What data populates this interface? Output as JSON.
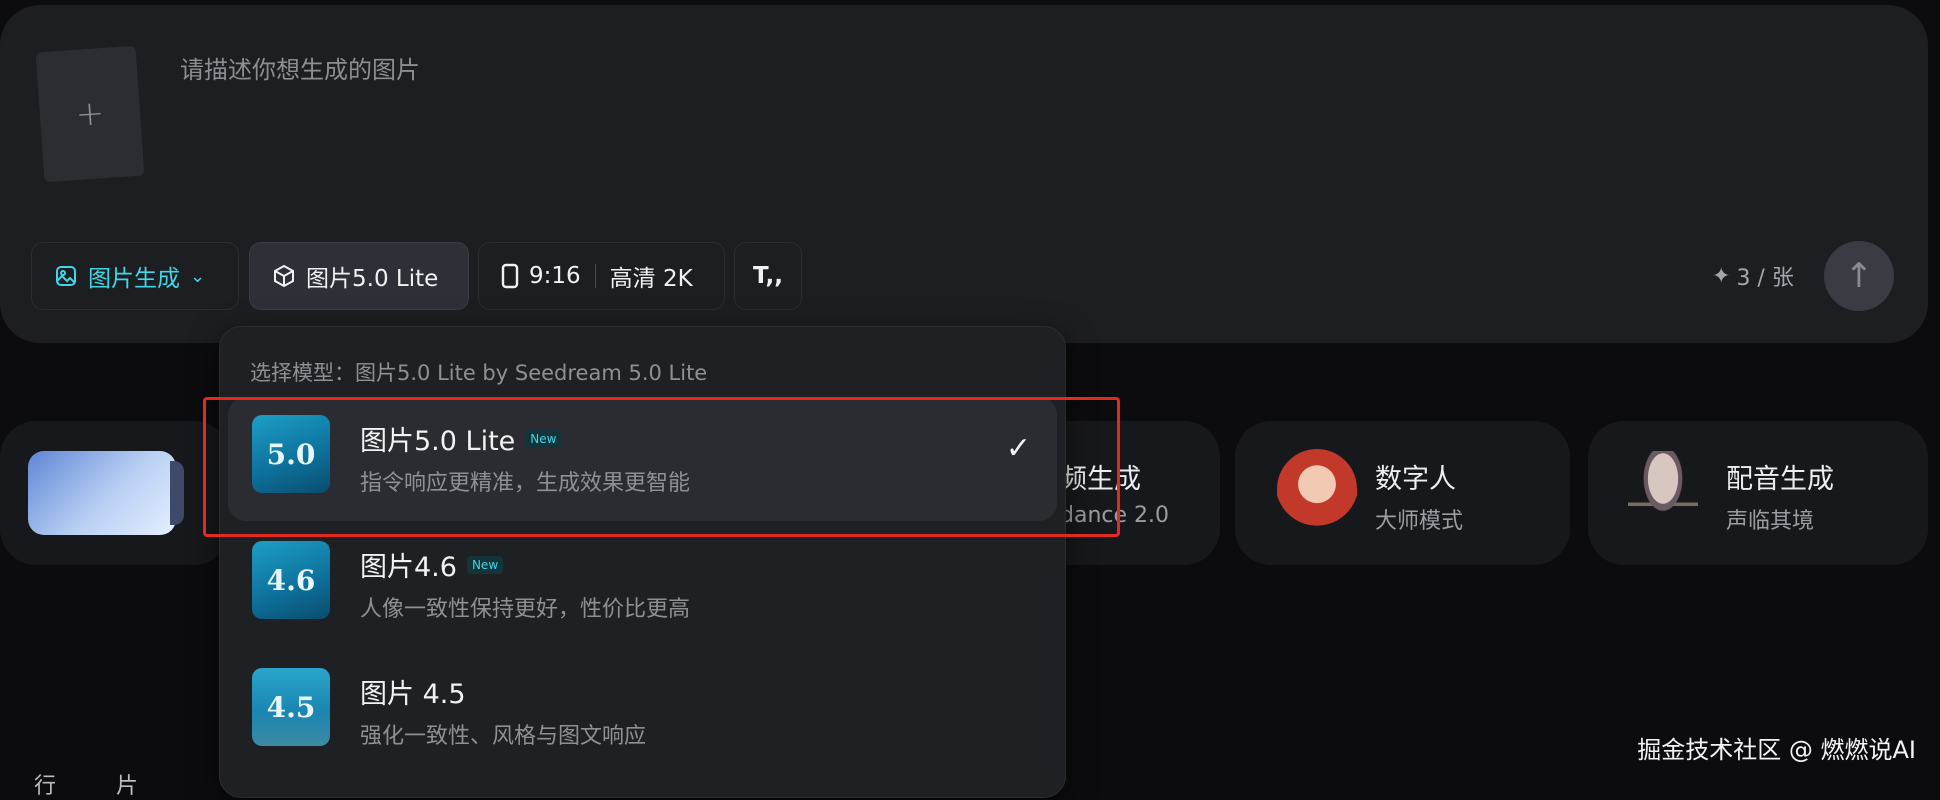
{
  "prompt": {
    "upload_label": "+",
    "placeholder": "请描述你想生成的图片"
  },
  "toolbar": {
    "mode_label": "图片生成",
    "model_label": "图片5.0 Lite",
    "ratio_label": "9:16",
    "quality_label": "高清 2K",
    "text_tool_label": "T,,",
    "cost_label": "3 / 张",
    "send_icon": "arrow-up-icon"
  },
  "cards": [
    {
      "title": "频生成",
      "subtitle": "dance 2.0"
    },
    {
      "title": "数字人",
      "subtitle": "大师模式"
    },
    {
      "title": "配音生成",
      "subtitle": "声临其境"
    }
  ],
  "dropdown": {
    "header": "选择模型：图片5.0 Lite by Seedream 5.0 Lite",
    "items": [
      {
        "thumb": "5.0",
        "name": "图片5.0 Lite",
        "badge": "New",
        "desc": "指令响应更精准，生成效果更智能",
        "selected": true
      },
      {
        "thumb": "4.6",
        "name": "图片4.6",
        "badge": "New",
        "desc": "人像一致性保持更好，性价比更高",
        "selected": false
      },
      {
        "thumb": "4.5",
        "name": "图片 4.5",
        "badge": "",
        "desc": "强化一致性、风格与图文响应",
        "selected": false
      }
    ]
  },
  "watermark": "掘金技术社区 @ 燃燃说AI",
  "partial_bottom_text": "行片 添",
  "colors": {
    "accent": "#3fd6e6",
    "highlight_box": "#e12a22",
    "panel": "#1d1e22",
    "background": "#0c0c0e"
  }
}
